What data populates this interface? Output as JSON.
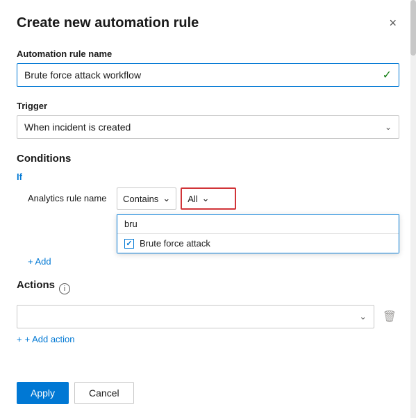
{
  "dialog": {
    "title": "Create new automation rule",
    "close_label": "×"
  },
  "form": {
    "rule_name_label": "Automation rule name",
    "rule_name_value": "Brute force attack workflow",
    "trigger_label": "Trigger",
    "trigger_value": "When incident is created",
    "conditions_label": "Conditions",
    "if_label": "If",
    "condition_field": "Analytics rule name",
    "condition_operator": "Contains",
    "condition_value_label": "All",
    "search_placeholder": "bru",
    "add_condition_label": "+ Add",
    "brute_force_option": "Brute force attack",
    "actions_label": "Actions",
    "info_icon_label": "i",
    "action_placeholder": "",
    "add_action_label": "+ Add action"
  },
  "footer": {
    "apply_label": "Apply",
    "cancel_label": "Cancel"
  },
  "icons": {
    "chevron": "∨",
    "checkmark": "✓",
    "trash": "🗑",
    "close": "×",
    "plus": "+"
  }
}
